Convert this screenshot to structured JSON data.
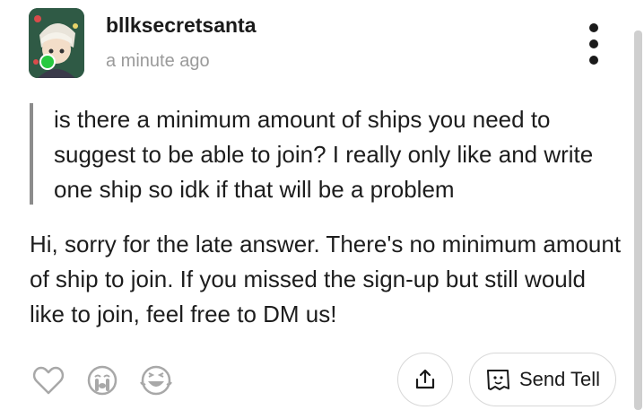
{
  "post": {
    "username": "bllksecretsanta",
    "timestamp": "a minute ago",
    "question": "is there a minimum amount of ships you need to suggest to be able to join? I really only like and write one ship so idk if that will be a problem",
    "answer": "Hi, sorry for the late answer. There's no minimum amount of ship to join. If you missed the sign-up but still would like to join, feel free to DM us!"
  },
  "actions": {
    "send_tell_label": "Send Tell"
  },
  "icons": {
    "more": "more-vertical-icon",
    "like": "heart-outline-icon",
    "cry": "crying-face-icon",
    "laugh": "laughing-face-icon",
    "share": "share-icon",
    "tell": "ghost-note-icon"
  },
  "colors": {
    "online": "#27c93f",
    "quote_bar": "#8c8c8c",
    "icon_gray": "#a8a8a8"
  }
}
